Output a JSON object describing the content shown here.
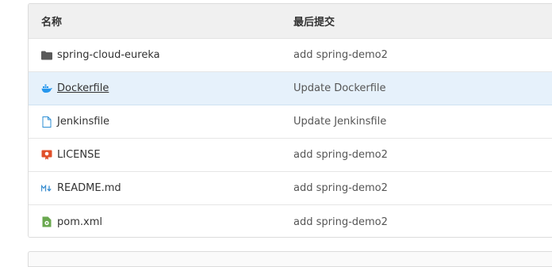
{
  "table": {
    "header": {
      "name": "名称",
      "commit": "最后提交"
    },
    "rows": [
      {
        "name": "spring-cloud-eureka",
        "commit": "add spring-demo2",
        "icon": "folder-icon"
      },
      {
        "name": "Dockerfile",
        "commit": "Update Dockerfile",
        "icon": "docker-icon"
      },
      {
        "name": "Jenkinsfile",
        "commit": "Update Jenkinsfile",
        "icon": "file-icon"
      },
      {
        "name": "LICENSE",
        "commit": "add spring-demo2",
        "icon": "license-icon"
      },
      {
        "name": "README.md",
        "commit": "add spring-demo2",
        "icon": "markdown-icon"
      },
      {
        "name": "pom.xml",
        "commit": "add spring-demo2",
        "icon": "xml-file-icon"
      }
    ]
  },
  "colors": {
    "header_bg": "#f0f0f0",
    "highlight_row": "#e6f1fb",
    "docker_blue": "#2496ed",
    "license_red": "#e0502a",
    "xml_green": "#6aa84f"
  }
}
